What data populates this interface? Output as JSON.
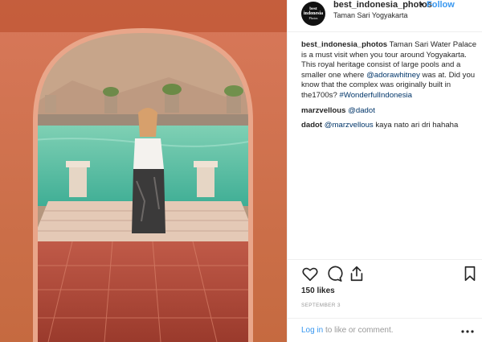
{
  "post": {
    "username": "best_indonesia_photos",
    "separator": "•",
    "follow_label": "Follow",
    "location": "Taman Sari Yogyakarta",
    "avatar_text": [
      "best",
      "indonesia",
      "Photos"
    ],
    "caption": {
      "username": "best_indonesia_photos",
      "text_1": " Taman Sari Water Palace is a must visit when you tour around Yogyakarta. This royal heritage consist of large pools and a smaller one where ",
      "mention": "@adorawhitney",
      "text_2": " was at. Did you know that the complex was originally built in the1700s? ",
      "hashtag": "#WonderfulIndonesia"
    },
    "comments": [
      {
        "username": "marzvellous",
        "mention": "@dadot",
        "text": ""
      },
      {
        "username": "dadot",
        "mention": "@marzvellous",
        "text": " kaya nato ari dri hahaha"
      }
    ],
    "likes": "150 likes",
    "date": "SEPTEMBER 3",
    "login_link": "Log in",
    "login_text": " to like or comment."
  },
  "icons": {
    "like": "heart-icon",
    "comment": "comment-icon",
    "share": "share-icon",
    "save": "bookmark-icon",
    "more": "more-icon"
  },
  "colors": {
    "link": "#3897f0",
    "mention": "#003569",
    "text": "#262626",
    "muted": "#999999"
  }
}
